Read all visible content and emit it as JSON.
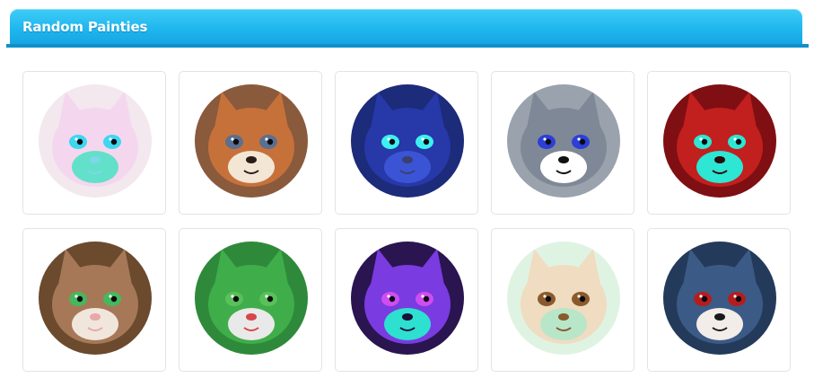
{
  "section": {
    "title": "Random Painties"
  },
  "painties": [
    {
      "id": "painty-1",
      "palette": {
        "bg": "#f2e8ee",
        "fur": "#f4d7ee",
        "accent": "#63e0c9",
        "eye": "#3fd6f0",
        "nose": "#7ed7e8"
      }
    },
    {
      "id": "painty-2",
      "palette": {
        "bg": "#8a5a3c",
        "fur": "#c7713a",
        "accent": "#f3e6d5",
        "eye": "#5b6f8e",
        "nose": "#2a1d18"
      }
    },
    {
      "id": "painty-3",
      "palette": {
        "bg": "#1c2b7a",
        "fur": "#2738a8",
        "accent": "#3b54d6",
        "eye": "#3df0f0",
        "nose": "#3a3f6e"
      }
    },
    {
      "id": "painty-4",
      "palette": {
        "bg": "#9aa2ad",
        "fur": "#7f8896",
        "accent": "#ffffff",
        "eye": "#2c3fd6",
        "nose": "#111111"
      }
    },
    {
      "id": "painty-5",
      "palette": {
        "bg": "#7f0f12",
        "fur": "#c21f1f",
        "accent": "#2de6d3",
        "eye": "#2de6d3",
        "nose": "#2a0a0a"
      }
    },
    {
      "id": "painty-6",
      "palette": {
        "bg": "#6b4a2e",
        "fur": "#a67858",
        "accent": "#f0e6dc",
        "eye": "#46b85c",
        "nose": "#e7a8a8"
      }
    },
    {
      "id": "painty-7",
      "palette": {
        "bg": "#2e8a3a",
        "fur": "#3fae4a",
        "accent": "#e9e9e9",
        "eye": "#5ac05a",
        "nose": "#d6464a"
      }
    },
    {
      "id": "painty-8",
      "palette": {
        "bg": "#2a1550",
        "fur": "#7a3be0",
        "accent": "#2de0d0",
        "eye": "#cf4df0",
        "nose": "#1c0f38"
      }
    },
    {
      "id": "painty-9",
      "palette": {
        "bg": "#dff3e3",
        "fur": "#f0dcc0",
        "accent": "#b8e6c9",
        "eye": "#8a5a2e",
        "nose": "#8a5a2e"
      }
    },
    {
      "id": "painty-10",
      "palette": {
        "bg": "#233a5a",
        "fur": "#3c5a86",
        "accent": "#f2ede8",
        "eye": "#b51d1d",
        "nose": "#1a1a1a"
      }
    }
  ]
}
